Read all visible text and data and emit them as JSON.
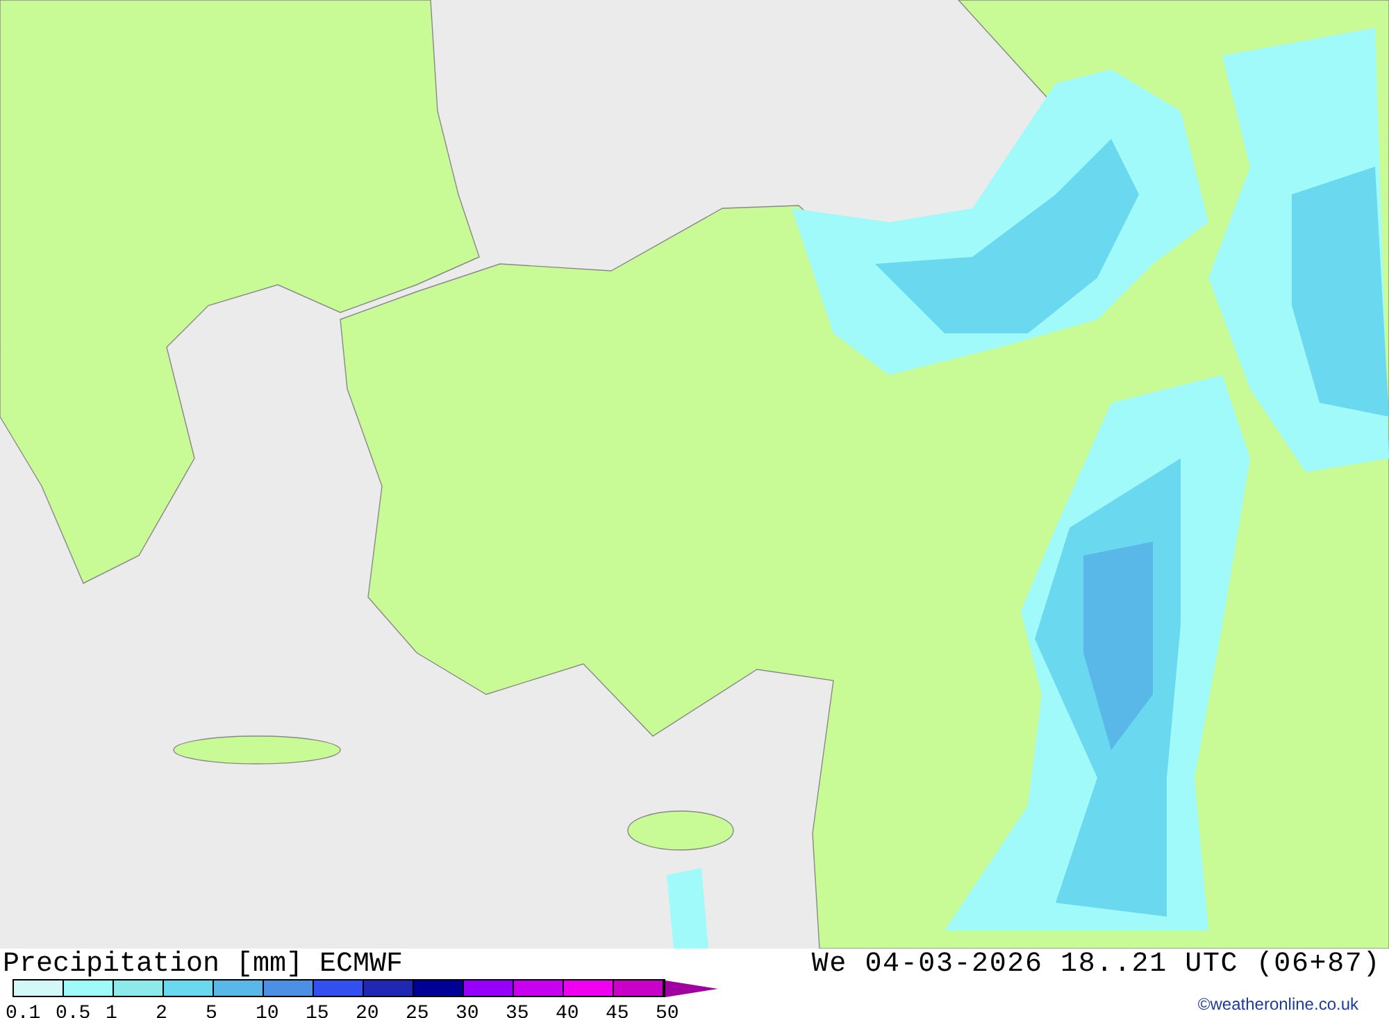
{
  "title": "Precipitation [mm] ECMWF",
  "valid_time": "We 04-03-2026 18..21 UTC (06+87)",
  "legend": {
    "segments": [
      {
        "color": "#d2f8f8"
      },
      {
        "color": "#a0fafa"
      },
      {
        "color": "#8ceaea"
      },
      {
        "color": "#6ad8ee"
      },
      {
        "color": "#5ab8e8"
      },
      {
        "color": "#4c90e6"
      },
      {
        "color": "#3250f0"
      },
      {
        "color": "#1e28b4"
      },
      {
        "color": "#000096"
      },
      {
        "color": "#9600fa"
      },
      {
        "color": "#c800f0"
      },
      {
        "color": "#f000f0"
      },
      {
        "color": "#c800c8"
      }
    ],
    "arrow": {
      "color": "#a000a0"
    },
    "labels": [
      "0.1",
      "0.5",
      "1",
      "2",
      "5",
      "10",
      "15",
      "20",
      "25",
      "30",
      "35",
      "40",
      "45",
      "50"
    ]
  },
  "credit": "©weatheronline.co.uk"
}
